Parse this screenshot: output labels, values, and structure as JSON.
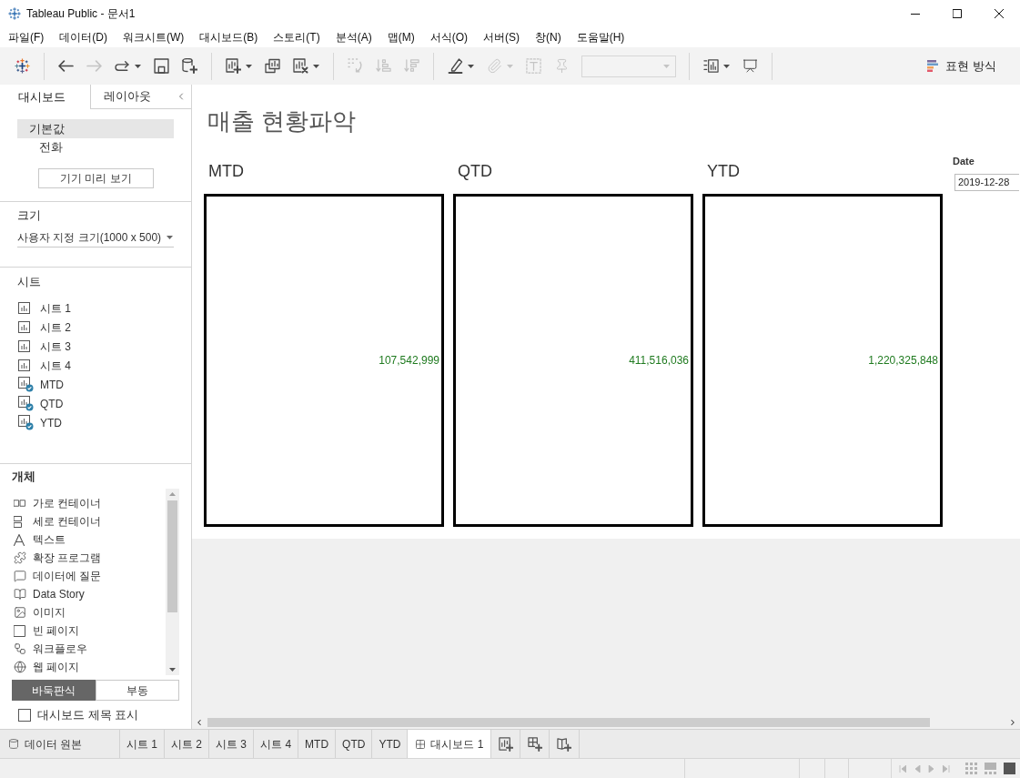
{
  "window": {
    "title": "Tableau Public - 문서1"
  },
  "menu": [
    "파일(F)",
    "데이터(D)",
    "워크시트(W)",
    "대시보드(B)",
    "스토리(T)",
    "분석(A)",
    "맵(M)",
    "서식(O)",
    "서버(S)",
    "창(N)",
    "도움말(H)"
  ],
  "toolbar": {
    "groups": [
      [
        {
          "kind": "button",
          "disabled": false,
          "menu": false
        }
      ],
      [
        {
          "kind": "button",
          "disabled": false,
          "menu": false
        },
        {
          "kind": "button",
          "disabled": true,
          "menu": false
        },
        {
          "kind": "button",
          "disabled": false,
          "menu": true
        },
        {
          "kind": "button",
          "disabled": false,
          "menu": false
        },
        {
          "kind": "button",
          "disabled": false,
          "menu": false
        }
      ],
      [
        {
          "kind": "button",
          "disabled": false,
          "menu": true
        },
        {
          "kind": "button",
          "disabled": false,
          "menu": false
        },
        {
          "kind": "button",
          "disabled": false,
          "menu": true
        }
      ],
      [
        {
          "kind": "button",
          "disabled": true,
          "menu": false
        },
        {
          "kind": "button",
          "disabled": true,
          "menu": false
        },
        {
          "kind": "button",
          "disabled": true,
          "menu": false
        }
      ],
      [
        {
          "kind": "button",
          "disabled": false,
          "menu": true
        },
        {
          "kind": "button",
          "disabled": true,
          "menu": true
        },
        {
          "kind": "button",
          "disabled": true,
          "menu": false
        },
        {
          "kind": "button",
          "disabled": true,
          "menu": false
        },
        {
          "kind": "field",
          "disabled": true
        }
      ],
      [
        {
          "kind": "button",
          "disabled": false,
          "menu": true
        },
        {
          "kind": "button",
          "disabled": false,
          "menu": false
        }
      ]
    ],
    "show_me": {
      "label": "표현 방식"
    }
  },
  "sidebar": {
    "tabs": [
      {
        "label": "대시보드",
        "selected": true
      },
      {
        "label": "레이아웃",
        "selected": false
      }
    ],
    "devices": [
      {
        "label": "기본값",
        "selected": true,
        "children": [
          {
            "label": "전화",
            "selected": false
          }
        ]
      }
    ],
    "preview_button": "기기 미리 보기",
    "size": {
      "title": "크기",
      "value": "사용자 지정 크기(1000 x 500)"
    },
    "sheets": {
      "title": "시트",
      "items": [
        {
          "label": "시트 1",
          "in_dashboard": false
        },
        {
          "label": "시트 2",
          "in_dashboard": false
        },
        {
          "label": "시트 3",
          "in_dashboard": false
        },
        {
          "label": "시트 4",
          "in_dashboard": false
        },
        {
          "label": "MTD",
          "in_dashboard": true
        },
        {
          "label": "QTD",
          "in_dashboard": true
        },
        {
          "label": "YTD",
          "in_dashboard": true
        }
      ]
    },
    "objects": {
      "title": "개체",
      "items": [
        "가로 컨테이너",
        "세로 컨테이너",
        "텍스트",
        "확장 프로그램",
        "데이터에 질문",
        "Data Story",
        "이미지",
        "빈 페이지",
        "워크플로우",
        "웹 페이지"
      ]
    },
    "layout_modes": [
      {
        "label": "바둑판식",
        "selected": true
      },
      {
        "label": "부동",
        "selected": false
      }
    ],
    "show_title": {
      "label": "대시보드 제목 표시",
      "checked": false
    }
  },
  "dashboard": {
    "title": "매출 현황파악",
    "panels": [
      {
        "title": "MTD",
        "value": "107,542,999"
      },
      {
        "title": "QTD",
        "value": "411,516,036"
      },
      {
        "title": "YTD",
        "value": "1,220,325,848"
      }
    ],
    "filter": {
      "label": "Date",
      "value": "2019-12-28"
    }
  },
  "sheet_tabs": [
    {
      "kind": "data",
      "label": "데이터 원본",
      "selected": false
    },
    {
      "kind": "sheet",
      "label": "시트 1",
      "selected": false
    },
    {
      "kind": "sheet",
      "label": "시트 2",
      "selected": false
    },
    {
      "kind": "sheet",
      "label": "시트 3",
      "selected": false
    },
    {
      "kind": "sheet",
      "label": "시트 4",
      "selected": false
    },
    {
      "kind": "sheet",
      "label": "MTD",
      "selected": false
    },
    {
      "kind": "sheet",
      "label": "QTD",
      "selected": false
    },
    {
      "kind": "sheet",
      "label": "YTD",
      "selected": false
    },
    {
      "kind": "dashboard",
      "label": "대시보드 1",
      "selected": true
    }
  ],
  "status_bar": {
    "navigation": [
      {
        "disabled": true
      },
      {
        "disabled": true
      },
      {
        "disabled": true
      },
      {
        "disabled": true
      }
    ],
    "view_modes": [
      {
        "selected": false
      },
      {
        "selected": false
      },
      {
        "selected": true
      }
    ]
  }
}
